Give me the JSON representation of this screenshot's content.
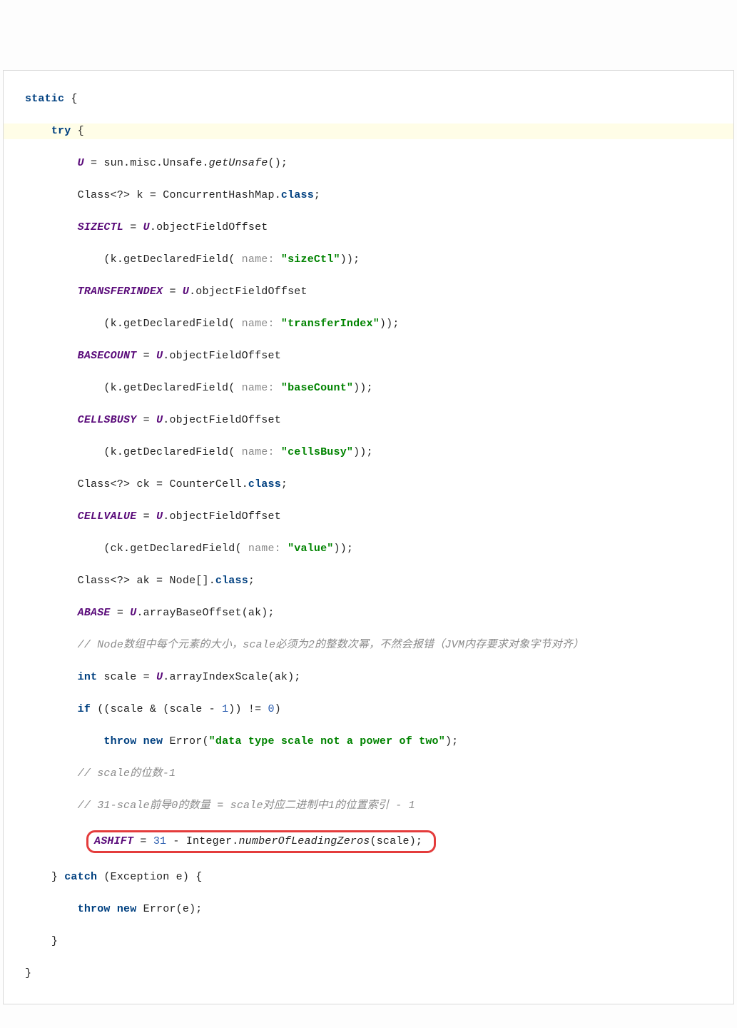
{
  "code": {
    "kw_static": "static",
    "kw_try": "try",
    "kw_class": "class",
    "kw_int": "int",
    "kw_if": "if",
    "kw_throw": "throw",
    "kw_new": "new",
    "kw_catch": "catch",
    "U": "U",
    "SIZECTL": "SIZECTL",
    "TRANSFERINDEX": "TRANSFERINDEX",
    "BASECOUNT": "BASECOUNT",
    "CELLSBUSY": "CELLSBUSY",
    "CELLVALUE": "CELLVALUE",
    "ABASE": "ABASE",
    "ASHIFT": "ASHIFT",
    "getUnsafe": "getUnsafe",
    "objectFieldOffset": "objectFieldOffset",
    "getDeclaredField": "getDeclaredField",
    "arrayBaseOffset": "arrayBaseOffset",
    "arrayIndexScale": "arrayIndexScale",
    "numberOfLeadingZeros": "numberOfLeadingZeros",
    "sun_misc_Unsafe": "sun.misc.Unsafe",
    "ConcurrentHashMap": "ConcurrentHashMap",
    "CounterCell": "CounterCell",
    "Node_arr": "Node[]",
    "Integer": "Integer",
    "Error": "Error",
    "Exception": "Exception",
    "name_hint": "name:",
    "sizeCtl": "\"sizeCtl\"",
    "transferIndex": "\"transferIndex\"",
    "baseCount": "\"baseCount\"",
    "cellsBusy": "\"cellsBusy\"",
    "value": "\"value\"",
    "err_msg": "\"data type scale not a power of two\"",
    "class_q": "Class<?>",
    "k": "k",
    "ck": "ck",
    "ak": "ak",
    "scale": "scale",
    "e": "e",
    "n31": "31",
    "n1": "1",
    "n0": "0",
    "comment1": "// Node数组中每个元素的大小，scale必须为2的整数次幂，不然会报错（JVM内存要求对象字节对齐）",
    "comment2": "// scale的位数-1",
    "comment3": "// 31-scale前导0的数量 = scale对应二进制中1的位置索引 - 1"
  }
}
